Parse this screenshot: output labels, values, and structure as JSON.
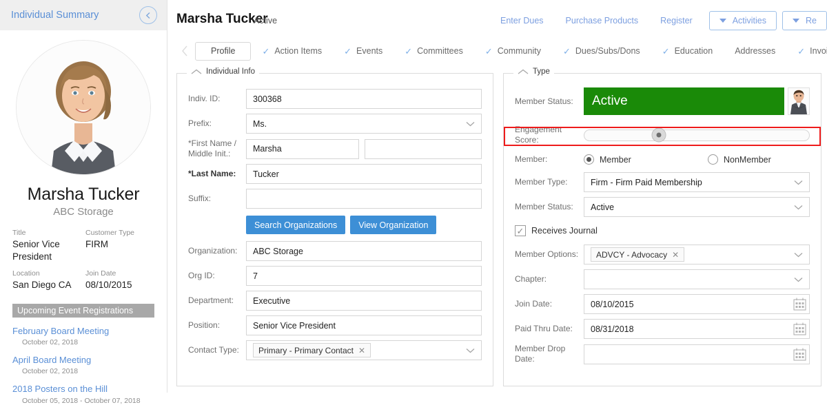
{
  "sidebar": {
    "title": "Individual Summary",
    "back_icon": "chevron-left-circle-icon",
    "person_name": "Marsha Tucker",
    "person_org": "ABC Storage",
    "meta": [
      {
        "label": "Title",
        "value": "Senior Vice President"
      },
      {
        "label": "Customer Type",
        "value": "FIRM"
      },
      {
        "label": "Location",
        "value": "San Diego CA"
      },
      {
        "label": "Join Date",
        "value": "08/10/2015"
      }
    ],
    "events_header": "Upcoming Event Registrations",
    "events": [
      {
        "name": "February Board Meeting",
        "date": "October 02, 2018"
      },
      {
        "name": "April Board Meeting",
        "date": "October 02, 2018"
      },
      {
        "name": "2018 Posters on the Hill",
        "date": "October 05, 2018 - October 07, 2018"
      }
    ]
  },
  "topbar": {
    "record_name": "Marsha Tucker",
    "record_status": "Active",
    "links": [
      "Enter Dues",
      "Purchase Products",
      "Register"
    ],
    "dropdowns": [
      "Activities",
      "Re"
    ]
  },
  "tabs": [
    {
      "label": "Profile",
      "active": true,
      "check": false
    },
    {
      "label": "Action Items",
      "active": false,
      "check": true
    },
    {
      "label": "Events",
      "active": false,
      "check": true
    },
    {
      "label": "Committees",
      "active": false,
      "check": true
    },
    {
      "label": "Community",
      "active": false,
      "check": true
    },
    {
      "label": "Dues/Subs/Dons",
      "active": false,
      "check": true
    },
    {
      "label": "Education",
      "active": false,
      "check": true
    },
    {
      "label": "Addresses",
      "active": false,
      "check": false
    },
    {
      "label": "Invoices",
      "active": false,
      "check": true
    }
  ],
  "individual_info": {
    "legend": "Individual Info",
    "indiv_id_label": "Indiv. ID:",
    "indiv_id_value": "300368",
    "prefix_label": "Prefix:",
    "prefix_value": "Ms.",
    "first_name_label": "*First Name / Middle Init.:",
    "first_name_value": "Marsha",
    "middle_init_value": "",
    "last_name_label": "*Last Name:",
    "last_name_value": "Tucker",
    "suffix_label": "Suffix:",
    "suffix_value": "",
    "search_org_button": "Search Organizations",
    "view_org_button": "View Organization",
    "organization_label": "Organization:",
    "organization_value": "ABC Storage",
    "org_id_label": "Org ID:",
    "org_id_value": "7",
    "department_label": "Department:",
    "department_value": "Executive",
    "position_label": "Position:",
    "position_value": "Senior Vice President",
    "contact_type_label": "Contact Type:",
    "contact_type_chip": "Primary - Primary Contact"
  },
  "type_panel": {
    "legend": "Type",
    "member_status_top_label": "Member Status:",
    "member_status_top_value": "Active",
    "member_status_color": "#1a8a08",
    "engagement_label": "Engagement Score:",
    "engagement_highlight_color": "#ee1b1b",
    "engagement_position_percent": 33,
    "member_label": "Member:",
    "member_option_1": "Member",
    "member_option_2": "NonMember",
    "member_type_label": "Member Type:",
    "member_type_value": "Firm - Firm Paid Membership",
    "member_status_label": "Member Status:",
    "member_status_value": "Active",
    "receives_journal_label": "Receives Journal",
    "member_options_label": "Member Options:",
    "member_options_chip": "ADVCY - Advocacy",
    "chapter_label": "Chapter:",
    "chapter_value": "",
    "join_date_label": "Join Date:",
    "join_date_value": "08/10/2015",
    "paid_thru_label": "Paid Thru Date:",
    "paid_thru_value": "08/31/2018",
    "member_drop_label": "Member Drop Date:",
    "member_drop_value": ""
  }
}
